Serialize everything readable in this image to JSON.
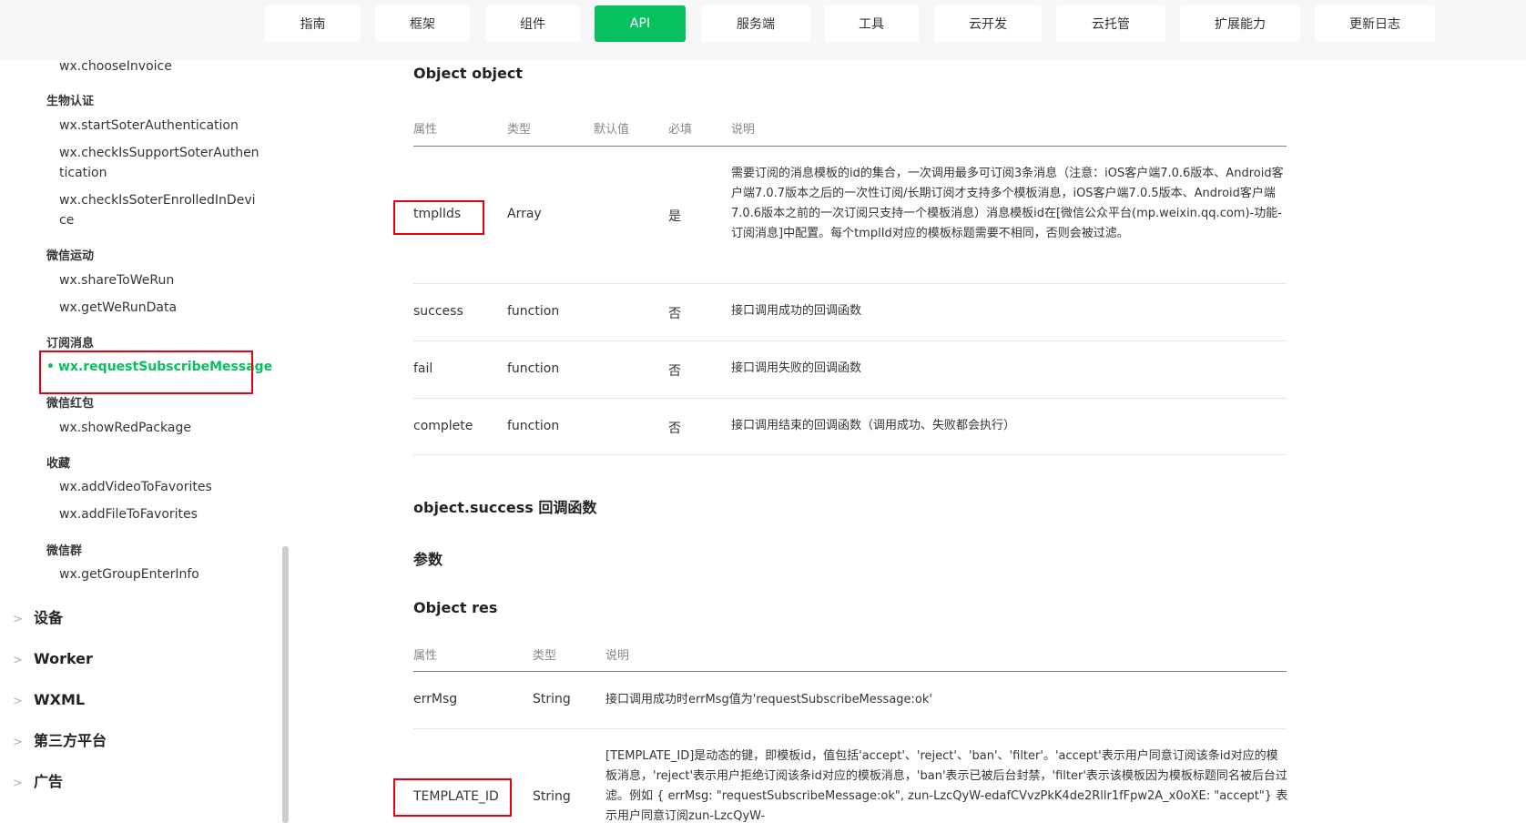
{
  "nav": {
    "tabs": [
      "指南",
      "框架",
      "组件",
      "API",
      "服务端",
      "工具",
      "云开发",
      "云托管",
      "扩展能力",
      "更新日志"
    ],
    "active": "API",
    "accent": "#07c160"
  },
  "sidebar": {
    "items": {
      "choose_invoice": "wx.chooseInvoice",
      "group_bio": "生物认证",
      "start_soter": "wx.startSoterAuthentication",
      "check_support_soter": "wx.checkIsSupportSoterAuthentication",
      "check_soter_enrolled": "wx.checkIsSoterEnrolledInDevice",
      "group_werun": "微信运动",
      "share_werun": "wx.shareToWeRun",
      "get_werun": "wx.getWeRunData",
      "group_subscribe": "订阅消息",
      "request_subscribe": "wx.requestSubscribeMessage",
      "group_redpackage": "微信红包",
      "show_redpackage": "wx.showRedPackage",
      "group_favorites": "收藏",
      "add_video_fav": "wx.addVideoToFavorites",
      "add_file_fav": "wx.addFileToFavorites",
      "group_wxgroup": "微信群",
      "get_group_enter": "wx.getGroupEnterInfo"
    },
    "sections": [
      "设备",
      "Worker",
      "WXML",
      "第三方平台",
      "广告"
    ]
  },
  "content": {
    "object_heading": "Object object",
    "params_table": {
      "headers": [
        "属性",
        "类型",
        "默认值",
        "必填",
        "说明"
      ],
      "rows": [
        {
          "name": "tmplIds",
          "type": "Array",
          "default": "",
          "required": "是",
          "desc": "需要订阅的消息模板的id的集合，一次调用最多可订阅3条消息（注意：iOS客户端7.0.6版本、Android客户端7.0.7版本之后的一次性订阅/长期订阅才支持多个模板消息，iOS客户端7.0.5版本、Android客户端7.0.6版本之前的一次订阅只支持一个模板消息）消息模板id在[微信公众平台(mp.weixin.qq.com)-功能-订阅消息]中配置。每个tmplId对应的模板标题需要不相同，否则会被过滤。"
        },
        {
          "name": "success",
          "type": "function",
          "default": "",
          "required": "否",
          "desc": "接口调用成功的回调函数"
        },
        {
          "name": "fail",
          "type": "function",
          "default": "",
          "required": "否",
          "desc": "接口调用失败的回调函数"
        },
        {
          "name": "complete",
          "type": "function",
          "default": "",
          "required": "否",
          "desc": "接口调用结束的回调函数（调用成功、失败都会执行）"
        }
      ]
    },
    "success_heading": "object.success 回调函数",
    "params_heading": "参数",
    "res_heading": "Object res",
    "res_table": {
      "headers": [
        "属性",
        "类型",
        "说明"
      ],
      "rows": [
        {
          "name": "errMsg",
          "type": "String",
          "desc": "接口调用成功时errMsg值为'requestSubscribeMessage:ok'"
        },
        {
          "name": "TEMPLATE_ID",
          "type": "String",
          "desc": "[TEMPLATE_ID]是动态的键，即模板id，值包括'accept'、'reject'、'ban'、'filter'。'accept'表示用户同意订阅该条id对应的模板消息，'reject'表示用户拒绝订阅该条id对应的模板消息，'ban'表示已被后台封禁，'filter'表示该模板因为模板标题同名被后台过滤。例如 { errMsg: \"requestSubscribeMessage:ok\", zun-LzcQyW-edafCVvzPkK4de2Rllr1fFpw2A_x0oXE: \"accept\"} 表示用户同意订阅zun-LzcQyW-"
        }
      ]
    }
  }
}
